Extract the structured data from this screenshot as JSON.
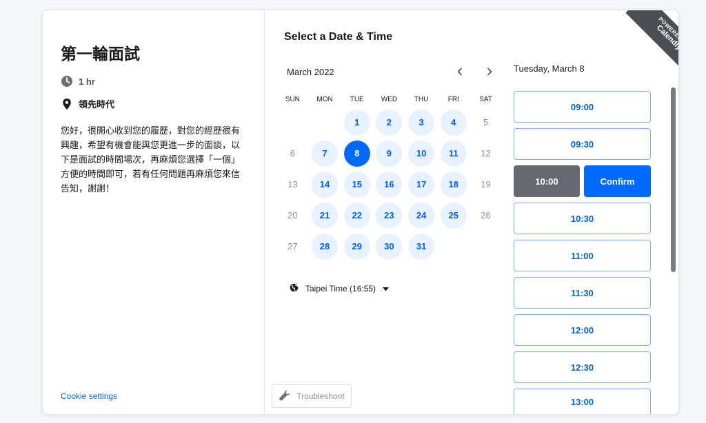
{
  "event": {
    "title": "第一輪面試",
    "duration": "1 hr",
    "location": "領先時代",
    "description": "您好，很開心收到您的履歷，對您的經歷很有興趣，希望有機會能與您更進一步的面談，以下是面試的時間場次，再麻煩您選擇「一個」方便的時間即可，若有任何問題再麻煩您來信告知，謝謝！"
  },
  "footer": {
    "cookie_settings": "Cookie settings",
    "troubleshoot": "Troubleshoot"
  },
  "scheduler": {
    "title": "Select a Date & Time",
    "month": "March 2022",
    "weekdays": [
      "SUN",
      "MON",
      "TUE",
      "WED",
      "THU",
      "FRI",
      "SAT"
    ],
    "days": [
      {
        "label": "",
        "state": "empty"
      },
      {
        "label": "",
        "state": "empty"
      },
      {
        "label": "1",
        "state": "available"
      },
      {
        "label": "2",
        "state": "available"
      },
      {
        "label": "3",
        "state": "available"
      },
      {
        "label": "4",
        "state": "available"
      },
      {
        "label": "5",
        "state": "unavailable"
      },
      {
        "label": "6",
        "state": "unavailable"
      },
      {
        "label": "7",
        "state": "available"
      },
      {
        "label": "8",
        "state": "selected"
      },
      {
        "label": "9",
        "state": "available"
      },
      {
        "label": "10",
        "state": "available"
      },
      {
        "label": "11",
        "state": "available"
      },
      {
        "label": "12",
        "state": "unavailable"
      },
      {
        "label": "13",
        "state": "unavailable"
      },
      {
        "label": "14",
        "state": "available"
      },
      {
        "label": "15",
        "state": "available"
      },
      {
        "label": "16",
        "state": "available"
      },
      {
        "label": "17",
        "state": "available"
      },
      {
        "label": "18",
        "state": "available"
      },
      {
        "label": "19",
        "state": "unavailable"
      },
      {
        "label": "20",
        "state": "unavailable"
      },
      {
        "label": "21",
        "state": "available"
      },
      {
        "label": "22",
        "state": "available"
      },
      {
        "label": "23",
        "state": "available"
      },
      {
        "label": "24",
        "state": "available"
      },
      {
        "label": "25",
        "state": "available"
      },
      {
        "label": "26",
        "state": "unavailable"
      },
      {
        "label": "27",
        "state": "unavailable"
      },
      {
        "label": "28",
        "state": "available"
      },
      {
        "label": "29",
        "state": "available"
      },
      {
        "label": "30",
        "state": "available"
      },
      {
        "label": "31",
        "state": "available"
      }
    ],
    "timezone": "Taipei Time (16:55)",
    "selected_date": "Tuesday, March 8",
    "times": [
      "09:00",
      "09:30",
      "10:00",
      "10:30",
      "11:00",
      "11:30",
      "12:00",
      "12:30",
      "13:00"
    ],
    "selected_time": "10:00",
    "confirm_label": "Confirm"
  },
  "badge": {
    "line1": "POWERED BY",
    "line2": "Calendly"
  },
  "icons": {
    "duration": "clock-icon",
    "location": "map-pin-icon",
    "timezone": "globe-icon",
    "timezone_toggle": "caret-down-icon",
    "prev": "chevron-left-icon",
    "next": "chevron-right-icon",
    "troubleshoot": "wrench-icon"
  },
  "colors": {
    "primary": "#0069ff",
    "available_bg": "#e8f1ff",
    "selected_time_bg": "#666a70",
    "badge_bg": "#4b4f54"
  }
}
